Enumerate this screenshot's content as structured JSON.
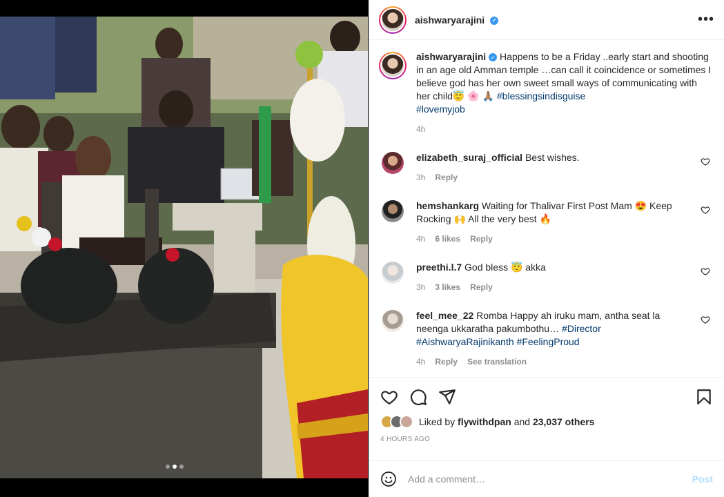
{
  "post": {
    "username": "aishwaryarajini",
    "verified_badge": "✓",
    "more_icon": "more-horizontal-icon",
    "carousel_count": 3,
    "carousel_active_index": 1
  },
  "caption": {
    "username": "aishwaryarajini",
    "text": " Happens to be a Friday ..early start and shooting in an age old Amman temple …can call it coincidence or sometimes I believe god has her own sweet small ways of communicating with her child😇 🌸 🙏🏽 ",
    "hashtag1": "#blessingsindisguise",
    "hashtag2": "#lovemyjob",
    "time": "4h"
  },
  "comments": [
    {
      "username": "elizabeth_suraj_official",
      "text": " Best wishes.",
      "time": "3h",
      "likes": "",
      "reply": "Reply",
      "avatar_color": "#b5476a"
    },
    {
      "username": "hemshankarg",
      "text": " Waiting for Thalivar First Post Mam 😍 Keep Rocking 🙌 All the very best 🔥",
      "time": "4h",
      "likes": "6 likes",
      "reply": "Reply",
      "avatar_color": "#6d6d6d"
    },
    {
      "username": "preethi.l.7",
      "text": " God bless 😇 akka",
      "time": "3h",
      "likes": "3 likes",
      "reply": "Reply",
      "avatar_color": "#d7d9dc"
    },
    {
      "username": "feel_mee_22",
      "text": " Romba Happy ah iruku mam, antha seat la neenga ukkaratha pakumbothu… ",
      "hashtag1": "#Director",
      "hashtag2": "#AishwaryaRajinikanth",
      "hashtag3": "#FeelingProud",
      "time": "4h",
      "reply": "Reply",
      "translate": "See translation",
      "avatar_color": "#cfc6bd"
    }
  ],
  "engagement": {
    "liked_by_prefix": "Liked by ",
    "liked_by_user": "flywithdpan",
    "liked_by_middle": " and ",
    "others": "23,037 others",
    "time_ago": "4 HOURS AGO"
  },
  "add_comment": {
    "placeholder": "Add a comment…",
    "post_label": "Post"
  },
  "colors": {
    "link": "#00376b",
    "muted": "#8e8e8e",
    "verified": "#3897f0",
    "post_disabled": "#b2dffc"
  }
}
